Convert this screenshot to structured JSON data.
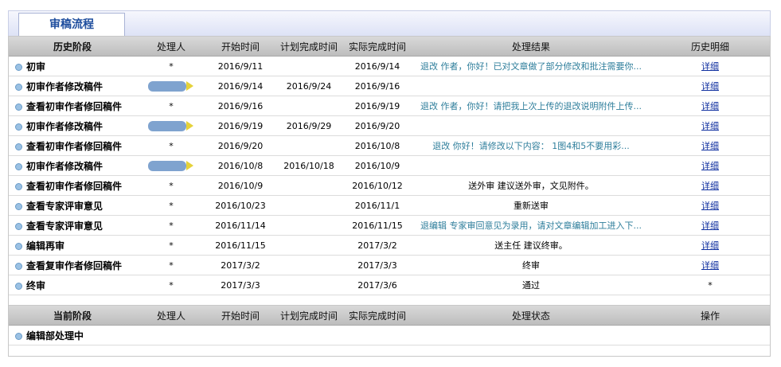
{
  "tab": {
    "label": "审稿流程"
  },
  "history": {
    "headers": [
      "历史阶段",
      "处理人",
      "开始时间",
      "计划完成时间",
      "实际完成时间",
      "处理结果",
      "历史明细"
    ],
    "rows": [
      {
        "stage": "初审",
        "handler": "*",
        "start": "2016/9/11",
        "planned": "",
        "actual": "2016/9/14",
        "result": "退改 作者，你好！已对文章做了部分修改和批注需要你...",
        "detail": "详细"
      },
      {
        "stage": "初审作者修改稿件",
        "handler": "",
        "start": "2016/9/14",
        "planned": "2016/9/24",
        "actual": "2016/9/16",
        "result": "",
        "detail": "详细"
      },
      {
        "stage": "查看初审作者修回稿件",
        "handler": "*",
        "start": "2016/9/16",
        "planned": "",
        "actual": "2016/9/19",
        "result": "退改 作者，你好！请把我上次上传的退改说明附件上传...",
        "detail": "详细"
      },
      {
        "stage": "初审作者修改稿件",
        "handler": "",
        "start": "2016/9/19",
        "planned": "2016/9/29",
        "actual": "2016/9/20",
        "result": "",
        "detail": "详细"
      },
      {
        "stage": "查看初审作者修回稿件",
        "handler": "*",
        "start": "2016/9/20",
        "planned": "",
        "actual": "2016/10/8",
        "result": "退改 你好！请修改以下内容： 1图4和5不要用彩...",
        "detail": "详细"
      },
      {
        "stage": "初审作者修改稿件",
        "handler": "",
        "start": "2016/10/8",
        "planned": "2016/10/18",
        "actual": "2016/10/9",
        "result": "",
        "detail": "详细"
      },
      {
        "stage": "查看初审作者修回稿件",
        "handler": "*",
        "start": "2016/10/9",
        "planned": "",
        "actual": "2016/10/12",
        "result": "送外审 建议送外审，文见附件。",
        "detail": "详细"
      },
      {
        "stage": "查看专家评审意见",
        "handler": "*",
        "start": "2016/10/23",
        "planned": "",
        "actual": "2016/11/1",
        "result": "重新送审",
        "detail": "详细"
      },
      {
        "stage": "查看专家评审意见",
        "handler": "*",
        "start": "2016/11/14",
        "planned": "",
        "actual": "2016/11/15",
        "result": "退编辑 专家审回意见为录用，请对文章编辑加工进入下...",
        "detail": "详细"
      },
      {
        "stage": "编辑再审",
        "handler": "*",
        "start": "2016/11/15",
        "planned": "",
        "actual": "2017/3/2",
        "result": "送主任 建议终审。",
        "detail": "详细"
      },
      {
        "stage": "查看复审作者修回稿件",
        "handler": "*",
        "start": "2017/3/2",
        "planned": "",
        "actual": "2017/3/3",
        "result": "终审",
        "detail": "详细"
      },
      {
        "stage": "终审",
        "handler": "*",
        "start": "2017/3/3",
        "planned": "",
        "actual": "2017/3/6",
        "result": "通过",
        "detail": "*"
      }
    ]
  },
  "current": {
    "headers": [
      "当前阶段",
      "处理人",
      "开始时间",
      "计划完成时间",
      "实际完成时间",
      "处理状态",
      "操作"
    ],
    "rows": [
      {
        "stage": "编辑部处理中",
        "handler": "",
        "start": "",
        "planned": "",
        "actual": "",
        "status": "",
        "action": ""
      }
    ]
  }
}
